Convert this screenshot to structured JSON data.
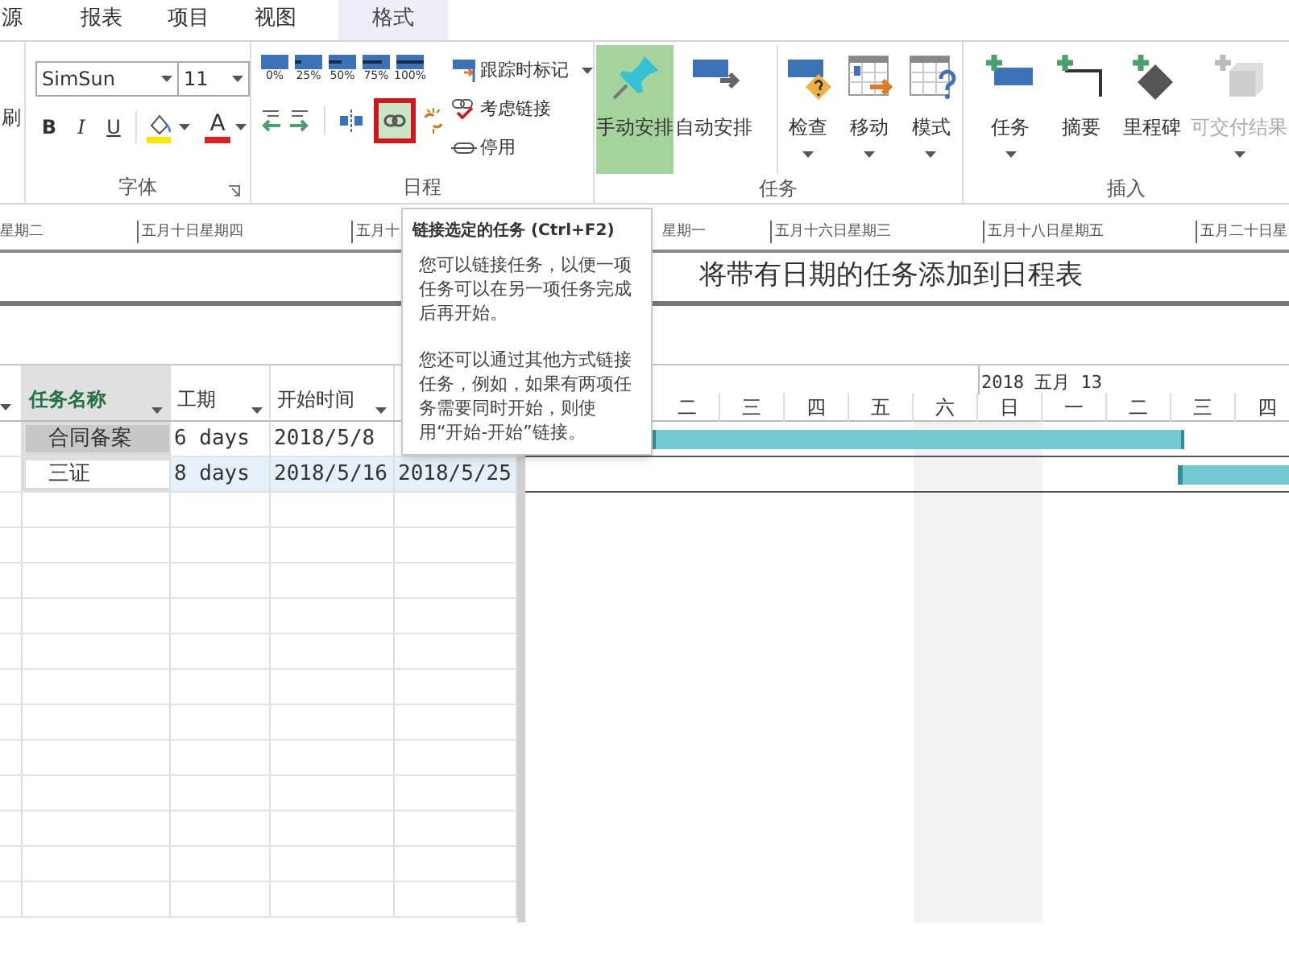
{
  "tabs": [
    {
      "label": "源",
      "selected": false
    },
    {
      "label": "报表",
      "selected": false
    },
    {
      "label": "项目",
      "selected": false
    },
    {
      "label": "视图",
      "selected": false
    },
    {
      "label": "格式",
      "selected": true
    }
  ],
  "ribbon": {
    "clipboard_group": {
      "partial_label": "刷"
    },
    "font_group": {
      "label": "字体",
      "font_name": "SimSun",
      "font_size": "11",
      "style_buttons": [
        "B",
        "I",
        "U"
      ],
      "font_color_letter": "A"
    },
    "schedule_group": {
      "label": "日程",
      "percent_buttons": [
        "0%",
        "25%",
        "50%",
        "75%",
        "100%"
      ],
      "link_button": {
        "highlighted": true
      },
      "commands": [
        "跟踪时标记",
        "考虑链接",
        "停用"
      ]
    },
    "tasks_group": {
      "label": "任务",
      "buttons": [
        {
          "label": "手动安排",
          "selected": true,
          "dropdown": false
        },
        {
          "label": "自动安排",
          "selected": false,
          "dropdown": false
        },
        {
          "label": "检查",
          "selected": false,
          "dropdown": true
        },
        {
          "label": "移动",
          "selected": false,
          "dropdown": true
        },
        {
          "label": "模式",
          "selected": false,
          "dropdown": true
        }
      ]
    },
    "insert_group": {
      "label": "插入",
      "buttons": [
        {
          "label": "任务",
          "disabled": false,
          "dropdown": true
        },
        {
          "label": "摘要",
          "disabled": false,
          "dropdown": false
        },
        {
          "label": "里程碑",
          "disabled": false,
          "dropdown": false
        },
        {
          "label": "可交付结果",
          "disabled": true,
          "dropdown": true
        }
      ]
    }
  },
  "timeline": {
    "date_labels": [
      "星期二",
      "五月十日星期四",
      "五月十",
      "星期一",
      "五月十六日星期三",
      "五月十八日星期五",
      "五月二十日星"
    ],
    "message": "将带有日期的任务添加到日程表"
  },
  "tooltip": {
    "title": "链接选定的任务 (Ctrl+F2)",
    "paragraphs": [
      "您可以链接任务，以便一项任务可以在另一项任务完成后再开始。",
      "您还可以通过其他方式链接任务，例如，如果有两项任务需要同时开始，则使用“开始-开始”链接。"
    ]
  },
  "table": {
    "columns": [
      {
        "label": "任务名称",
        "selected": true
      },
      {
        "label": "工期",
        "selected": false
      },
      {
        "label": "开始时间",
        "selected": false
      }
    ],
    "rows": [
      {
        "name": "合同备案",
        "duration": "6 days",
        "start": "2018/5/8",
        "active": true,
        "selected": false
      },
      {
        "name": "三证",
        "duration": "8 days",
        "start": "2018/5/16",
        "finish": "2018/5/25",
        "active": false,
        "selected": true
      }
    ]
  },
  "gantt": {
    "timescale_label": "2018 五月 13",
    "days": [
      {
        "label": "二",
        "weekend": false
      },
      {
        "label": "三",
        "weekend": false
      },
      {
        "label": "四",
        "weekend": false
      },
      {
        "label": "五",
        "weekend": false
      },
      {
        "label": "六",
        "weekend": true
      },
      {
        "label": "日",
        "weekend": true
      },
      {
        "label": "一",
        "weekend": false
      },
      {
        "label": "二",
        "weekend": false
      },
      {
        "label": "三",
        "weekend": false
      },
      {
        "label": "四",
        "weekend": false
      }
    ]
  }
}
